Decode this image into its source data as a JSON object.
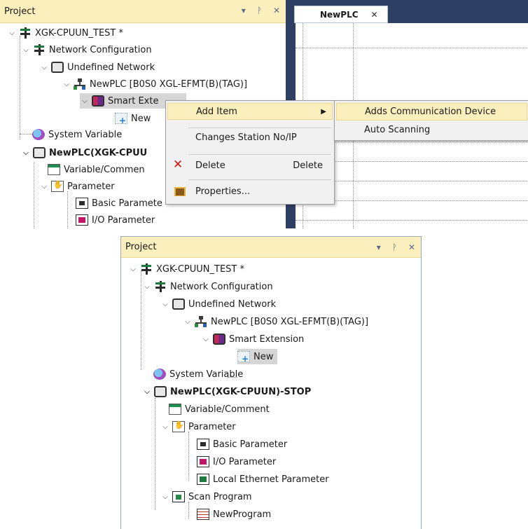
{
  "top": {
    "panel_title": "Project",
    "panel_controls": [
      "▾",
      "ᚹ",
      "✕"
    ],
    "tab": {
      "label": "NewPLC",
      "close": "✕"
    },
    "tree": [
      {
        "label": "XGK-CPUUN_TEST *",
        "icon": "network-icon"
      },
      {
        "label": "Network Configuration",
        "icon": "network-icon"
      },
      {
        "label": "Undefined Network",
        "icon": "plc-icon"
      },
      {
        "label": "NewPLC [B0S0 XGL-EFMT(B)(TAG)]",
        "icon": "tree-icon"
      },
      {
        "label": "Smart Exte",
        "icon": "plc-module-icon"
      },
      {
        "label": "New",
        "icon": "new-item-icon"
      },
      {
        "label": "System Variable",
        "icon": "system-variable-icon"
      },
      {
        "label": "NewPLC(XGK-CPUU",
        "icon": "plc-icon"
      },
      {
        "label": "Variable/Commen",
        "icon": "variable-icon"
      },
      {
        "label": "Parameter",
        "icon": "parameter-icon"
      },
      {
        "label": "Basic Paramete",
        "icon": "basic-parameter-icon"
      },
      {
        "label": "I/O Parameter",
        "icon": "io-parameter-icon"
      }
    ],
    "context_menu": {
      "add_item": "Add Item",
      "change_station": "Changes Station No/IP",
      "delete": "Delete",
      "delete_shortcut": "Delete",
      "properties": "Properties..."
    },
    "submenu": {
      "adds_comm": "Adds Communication Device",
      "auto_scan": "Auto Scanning"
    }
  },
  "bottom": {
    "panel_title": "Project",
    "panel_controls": [
      "▾",
      "ᚹ",
      "✕"
    ],
    "tree": [
      {
        "label": "XGK-CPUUN_TEST *"
      },
      {
        "label": "Network Configuration"
      },
      {
        "label": "Undefined Network"
      },
      {
        "label": "NewPLC [B0S0 XGL-EFMT(B)(TAG)]"
      },
      {
        "label": "Smart Extension"
      },
      {
        "label": "New"
      },
      {
        "label": "System Variable"
      },
      {
        "label": "NewPLC(XGK-CPUUN)-STOP"
      },
      {
        "label": "Variable/Comment"
      },
      {
        "label": "Parameter"
      },
      {
        "label": "Basic Parameter"
      },
      {
        "label": "I/O Parameter"
      },
      {
        "label": "Local Ethernet Parameter"
      },
      {
        "label": "Scan Program"
      },
      {
        "label": "NewProgram"
      }
    ]
  },
  "colors": {
    "header_bg": "#fbefbe",
    "menu_highlight": "#fbefbe",
    "dark_frame": "#2d3f62",
    "delete_icon": "#d01515"
  }
}
